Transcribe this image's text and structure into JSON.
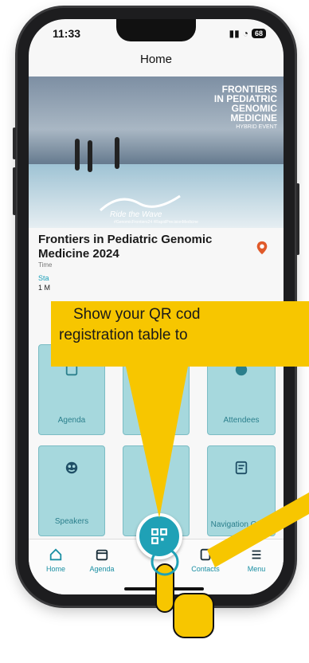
{
  "status": {
    "time": "11:33",
    "battery": "68"
  },
  "header": {
    "title": "Home"
  },
  "banner": {
    "line1": "FRONTIERS",
    "line2": "IN PEDIATRIC",
    "line3": "GENOMIC",
    "line4": "MEDICINE",
    "line5": "HYBRID EVENT",
    "logo_text": "Ride the Wave",
    "logo_sub": "of PEDIATRIC GENOMICS",
    "hashtags": "#GenomicFrontiers24  #RapidPrecisionMedicine"
  },
  "event": {
    "title": "Frontiers in Pediatric Genomic Medicine 2024",
    "time_label": "Time",
    "start_label": "Sta",
    "start_value": "1 M"
  },
  "tooltip": {
    "text_line1": "Show your QR cod",
    "text_line2": "registration table to"
  },
  "tiles": [
    {
      "label": "Agenda"
    },
    {
      "label": "Attendees"
    },
    {
      "label": "Speakers"
    },
    {
      "label": "Navigation Guide"
    }
  ],
  "nav": {
    "home": "Home",
    "agenda": "Agenda",
    "contacts": "Contacts",
    "menu": "Menu"
  },
  "colors": {
    "accent": "#1fa1b6",
    "tooltip": "#f7c600",
    "tile": "#a6d8dd"
  }
}
